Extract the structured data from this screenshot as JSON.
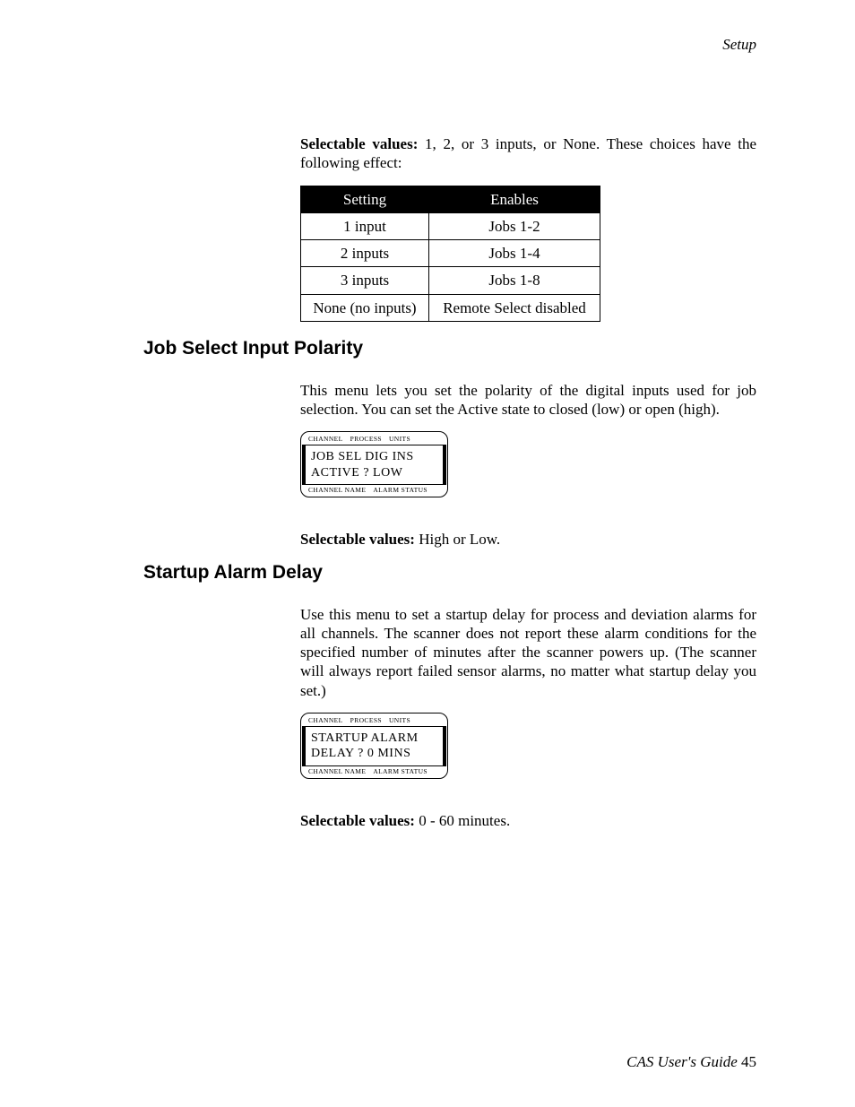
{
  "header": {
    "section": "Setup"
  },
  "intro": {
    "sv_label": "Selectable values:",
    "sv_text": " 1, 2, or 3 inputs, or None. These choices have the following effect:"
  },
  "table": {
    "headers": {
      "c0": "Setting",
      "c1": "Enables"
    },
    "rows": [
      {
        "c0": "1 input",
        "c1": "Jobs 1-2"
      },
      {
        "c0": "2 inputs",
        "c1": "Jobs 1-4"
      },
      {
        "c0": "3 inputs",
        "c1": "Jobs 1-8"
      },
      {
        "c0": "None (no inputs)",
        "c1": "Remote Select disabled"
      }
    ]
  },
  "sec1": {
    "title": "Job Select Input Polarity",
    "para": "This menu  lets you set the polarity of the digital inputs used for job selection. You can set the Active state to closed (low) or open (high).",
    "lcd": {
      "top_a": "CHANNEL",
      "top_b": "PROCESS",
      "top_c": "UNITS",
      "line1": "JOB  SEL  DIG  INS",
      "line2": "ACTIVE ?  LOW",
      "bot_a": "CHANNEL NAME",
      "bot_b": "ALARM STATUS"
    },
    "sv_label": "Selectable values:",
    "sv_text": " High or Low."
  },
  "sec2": {
    "title": "Startup Alarm Delay",
    "para": "Use this menu to set a startup delay for process and deviation alarms for all channels. The scanner does not report these alarm conditions for the specified number of minutes after the scanner powers up. (The scanner will always report failed sensor alarms, no matter what startup delay you set.)",
    "lcd": {
      "top_a": "CHANNEL",
      "top_b": "PROCESS",
      "top_c": "UNITS",
      "line1": "STARTUP  ALARM",
      "line2": "DELAY  ?  0  MINS",
      "bot_a": "CHANNEL NAME",
      "bot_b": "ALARM STATUS"
    },
    "sv_label": "Selectable values:",
    "sv_text": " 0 - 60 minutes."
  },
  "footer": {
    "title": "CAS User's Guide",
    "page": "45"
  }
}
